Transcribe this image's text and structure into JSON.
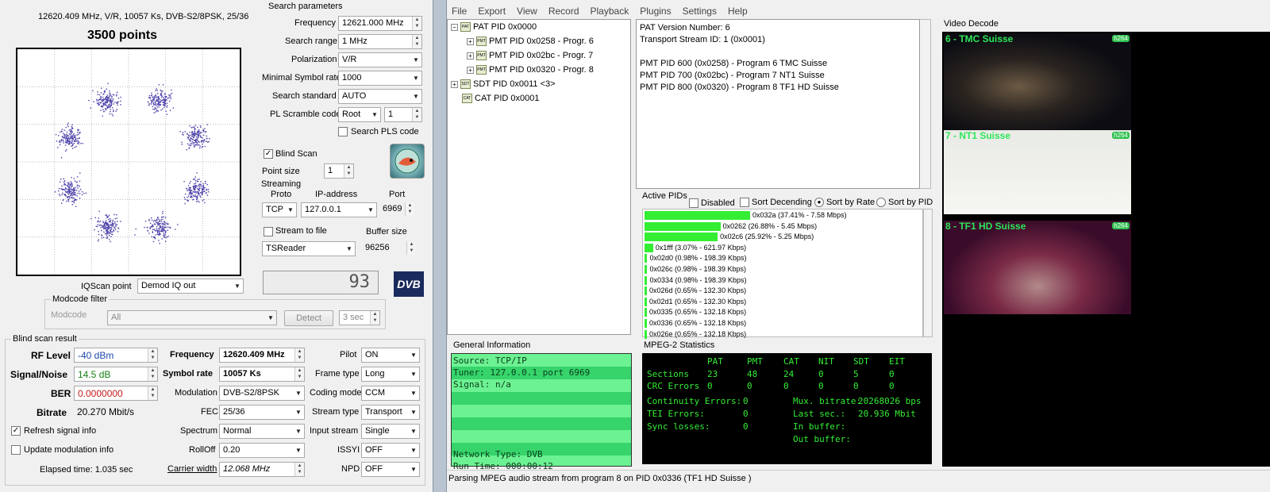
{
  "constellation": {
    "header": "12620.409 MHz, V/R, 10057 Ks, DVB-S2/8PSK, 25/36",
    "points_label": "3500 points"
  },
  "search": {
    "title": "Search parameters",
    "frequency_label": "Frequency",
    "frequency_value": "12621.000 MHz",
    "range_label": "Search range",
    "range_value": "1 MHz",
    "polarization_label": "Polarization",
    "polarization_value": "V/R",
    "minsym_label": "Minimal Symbol rate",
    "minsym_value": "1000",
    "standard_label": "Search standard",
    "standard_value": "AUTO",
    "pls_label": "PL Scramble code",
    "pls_mode": "Root",
    "pls_value": "1",
    "search_pls_label": "Search PLS code"
  },
  "blind": {
    "blind_scan_label": "Blind Scan",
    "point_size_label": "Point size",
    "point_size_value": "1"
  },
  "streaming": {
    "title": "Streaming",
    "proto_label": "Proto",
    "ip_label": "IP-address",
    "port_label": "Port",
    "proto_value": "TCP",
    "ip_value": "127.0.0.1",
    "port_value": "6969",
    "stream_to_file_label": "Stream to file",
    "buffer_label": "Buffer size",
    "reader_value": "TSReader",
    "buffer_value": "96256"
  },
  "lcd": {
    "value": "93"
  },
  "logo": {
    "text": "DVB"
  },
  "iq": {
    "label": "IQScan point",
    "value": "Demod IQ out"
  },
  "modcode": {
    "title": "Modcode filter",
    "label": "Modcode",
    "value": "All",
    "detect_label": "Detect",
    "interval_value": "3 sec"
  },
  "result": {
    "title": "Blind scan result",
    "rf_label": "RF Level",
    "rf_value": "-40 dBm",
    "sn_label": "Signal/Noise",
    "sn_value": "14.5 dB",
    "ber_label": "BER",
    "ber_value": "0.0000000",
    "bitrate_label": "Bitrate",
    "bitrate_value": "20.270 Mbit/s",
    "freq_label": "Frequency",
    "freq_value": "12620.409 MHz",
    "symrate_label": "Symbol rate",
    "symrate_value": "10057 Ks",
    "modulation_label": "Modulation",
    "modulation_value": "DVB-S2/8PSK",
    "fec_label": "FEC",
    "fec_value": "25/36",
    "spectrum_label": "Spectrum",
    "spectrum_value": "Normal",
    "rolloff_label": "RollOff",
    "rolloff_value": "0.20",
    "carrier_label": "Carrier width",
    "carrier_value": "12.068 MHz",
    "pilot_label": "Pilot",
    "pilot_value": "ON",
    "frame_label": "Frame type",
    "frame_value": "Long",
    "coding_label": "Coding mode",
    "coding_value": "CCM",
    "stream_type_label": "Stream type",
    "stream_type_value": "Transport",
    "input_label": "Input stream",
    "input_value": "Single",
    "issyi_label": "ISSYI",
    "issyi_value": "OFF",
    "npd_label": "NPD",
    "npd_value": "OFF",
    "refresh_label": "Refresh signal info",
    "update_label": "Update modulation info",
    "elapsed": "Elapsed time: 1.035 sec"
  },
  "menu": [
    "File",
    "Export",
    "View",
    "Record",
    "Playback",
    "Plugins",
    "Settings",
    "Help"
  ],
  "tree": {
    "pat": "PAT PID 0x0000",
    "pmt1": "PMT PID 0x0258 - Progr. 6",
    "pmt2": "PMT PID 0x02bc - Progr. 7",
    "pmt3": "PMT PID 0x0320 - Progr. 8",
    "sdt": "SDT PID 0x0011 <3>",
    "cat": "CAT PID 0x0001",
    "icon_pat": "PAT",
    "icon_pmt": "PMT",
    "icon_sdt": "SDT",
    "icon_cat": "CAT"
  },
  "pat_info": [
    "PAT Version Number: 6",
    "Transport Stream ID: 1 (0x0001)",
    "",
    "PMT PID 600 (0x0258) - Program 6 TMC Suisse",
    "PMT PID 700 (0x02bc) - Program 7 NT1 Suisse",
    "PMT PID 800 (0x0320) - Program 8 TF1 HD  Suisse"
  ],
  "active_pids": {
    "title": "Active PIDs",
    "disabled": "Disabled",
    "sort_desc": "Sort Decending",
    "sort_rate": "Sort by Rate",
    "sort_pid": "Sort by PID",
    "items": [
      {
        "label": "0x032a (37.41% - 7.58 Mbps)",
        "pct": 37.41
      },
      {
        "label": "0x0262 (26.88% - 5.45 Mbps)",
        "pct": 26.88
      },
      {
        "label": "0x02c6 (25.92% - 5.25 Mbps)",
        "pct": 25.92
      },
      {
        "label": "0x1fff (3.07% - 621.97 Kbps)",
        "pct": 3.07
      },
      {
        "label": "0x02d0 (0.98% - 198.39 Kbps)",
        "pct": 0.98
      },
      {
        "label": "0x026c (0.98% - 198.39 Kbps)",
        "pct": 0.98
      },
      {
        "label": "0x0334 (0.98% - 198.39 Kbps)",
        "pct": 0.98
      },
      {
        "label": "0x026d (0.65% - 132.30 Kbps)",
        "pct": 0.65
      },
      {
        "label": "0x02d1 (0.65% - 132.30 Kbps)",
        "pct": 0.65
      },
      {
        "label": "0x0335 (0.65% - 132.18 Kbps)",
        "pct": 0.65
      },
      {
        "label": "0x0336 (0.65% - 132.18 Kbps)",
        "pct": 0.65
      },
      {
        "label": "0x026e (0.65% - 132.18 Kbps)",
        "pct": 0.65
      }
    ]
  },
  "general": {
    "title": "General Information",
    "lines": [
      "Source: TCP/IP",
      "Tuner: 127.0.0.1 port 6969",
      "Signal: n/a",
      "",
      "",
      "",
      "",
      "",
      "Network Type: DVB",
      "Run Time: 000:00:12"
    ]
  },
  "mpeg": {
    "title": "MPEG-2 Statistics",
    "headers": [
      "PAT",
      "PMT",
      "CAT",
      "NIT",
      "SDT",
      "EIT"
    ],
    "sections_label": "Sections",
    "sections": [
      "23",
      "48",
      "24",
      "0",
      "5",
      "0"
    ],
    "crc_label": "CRC Errors",
    "crc": [
      "0",
      "0",
      "0",
      "0",
      "0",
      "0"
    ],
    "cont_label": "Continuity Errors:",
    "cont_value": "0",
    "tei_label": "TEI Errors:",
    "tei_value": "0",
    "sync_label": "Sync losses:",
    "sync_value": "0",
    "mux_label": "Mux. bitrate:",
    "mux_value": "20268026 bps",
    "last_label": "Last sec.:",
    "last_value": "20.936 Mbit",
    "inbuf_label": "In buffer:",
    "outbuf_label": "Out buffer:"
  },
  "video": {
    "title": "Video Decode",
    "codec": "h264",
    "ch1": "6 - TMC Suisse",
    "ch2": "7 - NT1 Suisse",
    "ch3": "8 - TF1 HD  Suisse"
  },
  "status": "Parsing MPEG audio stream from program 8 on PID 0x0336 (TF1 HD  Suisse )"
}
